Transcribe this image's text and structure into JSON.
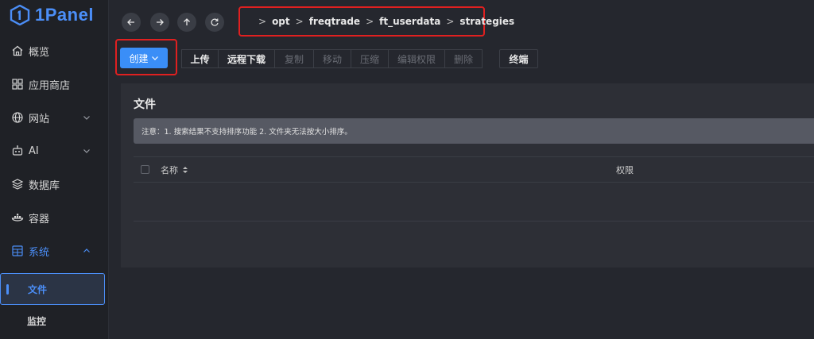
{
  "app": {
    "logo_text": "1Panel"
  },
  "sidebar": {
    "items": [
      {
        "label": "概览",
        "icon": "home-icon"
      },
      {
        "label": "应用商店",
        "icon": "grid-icon"
      },
      {
        "label": "网站",
        "icon": "globe-icon",
        "expandable": true
      },
      {
        "label": "AI",
        "icon": "robot-icon",
        "expandable": true
      },
      {
        "label": "数据库",
        "icon": "layers-icon"
      },
      {
        "label": "容器",
        "icon": "container-icon"
      },
      {
        "label": "系统",
        "icon": "system-icon",
        "expanded": true
      }
    ],
    "sub_items": [
      {
        "label": "文件",
        "active": true
      },
      {
        "label": "监控"
      }
    ]
  },
  "breadcrumb": {
    "home_icon": "home-icon",
    "items": [
      "opt",
      "freqtrade",
      "ft_userdata",
      "strategies"
    ],
    "separator": ">"
  },
  "toolbar": {
    "create_label": "创建",
    "buttons": [
      {
        "label": "上传",
        "enabled": true
      },
      {
        "label": "远程下载",
        "enabled": true
      },
      {
        "label": "复制",
        "enabled": false
      },
      {
        "label": "移动",
        "enabled": false
      },
      {
        "label": "压缩",
        "enabled": false
      },
      {
        "label": "编辑权限",
        "enabled": false
      },
      {
        "label": "删除",
        "enabled": false
      }
    ],
    "terminal_label": "终端"
  },
  "main": {
    "title": "文件",
    "notice": "注意：1. 搜索结果不支持排序功能 2. 文件夹无法按大小排序。",
    "table": {
      "columns": [
        "名称",
        "权限"
      ]
    }
  },
  "colors": {
    "accent": "#3a8ef7",
    "highlight_border": "#e02020"
  }
}
